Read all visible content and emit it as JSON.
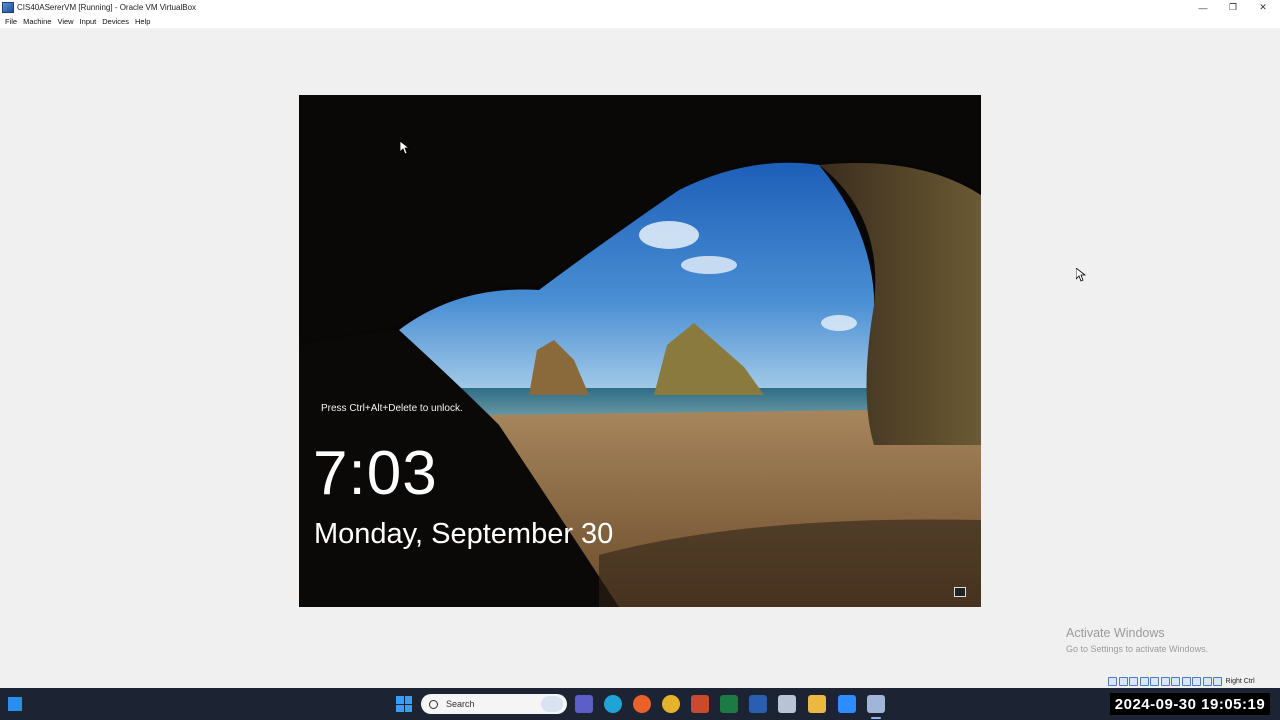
{
  "window": {
    "title": "CIS40ASererVM [Running] - Oracle VM VirtualBox",
    "minimize_glyph": "—",
    "maximize_glyph": "❐",
    "close_glyph": "✕"
  },
  "menubar": {
    "items": [
      "File",
      "Machine",
      "View",
      "Input",
      "Devices",
      "Help"
    ]
  },
  "lockscreen": {
    "hint": "Press Ctrl+Alt+Delete to unlock.",
    "time": "7:03",
    "date": "Monday, September 30"
  },
  "watermark": {
    "line1": "Activate Windows",
    "line2": "Go to Settings to activate Windows."
  },
  "vbox_status": {
    "host_key": "Right Ctrl"
  },
  "taskbar": {
    "search_label": "Search",
    "apps": [
      "teams-icon",
      "edge-icon",
      "firefox-icon",
      "chrome-icon",
      "powerpoint-icon",
      "excel-icon",
      "word-icon",
      "virtualbox-cube-icon",
      "file-explorer-icon",
      "zoom-icon",
      "virtualbox-icon"
    ]
  },
  "overlay_timestamp": "2024-09-30 19:05:19",
  "colors": {
    "taskbar": "#1c2333",
    "accent": "#3b9cf5"
  }
}
